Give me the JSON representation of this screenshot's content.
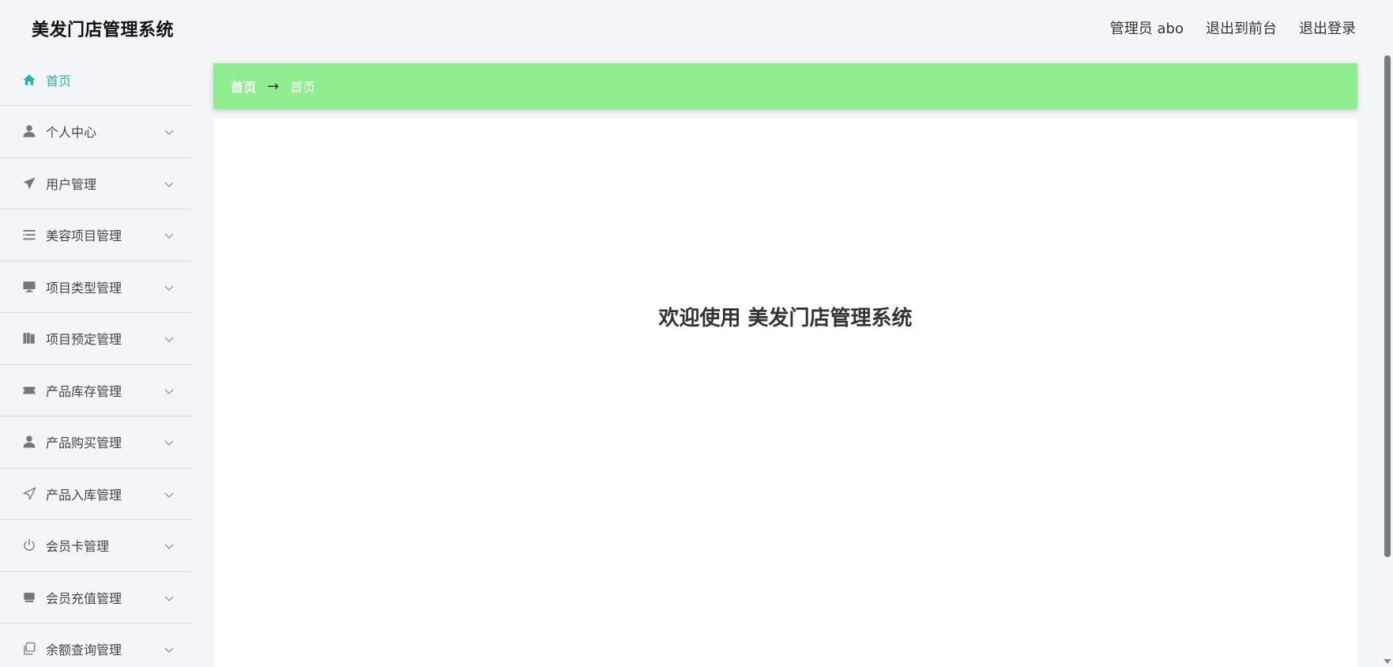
{
  "app": {
    "title": "美发门店管理系统"
  },
  "header": {
    "user_label": "管理员 abo",
    "front_label": "退出到前台",
    "logout_label": "退出登录"
  },
  "sidebar": {
    "items": [
      {
        "label": "首页",
        "icon": "home-icon"
      },
      {
        "label": "个人中心",
        "icon": "user-icon"
      },
      {
        "label": "用户管理",
        "icon": "paper-plane-icon"
      },
      {
        "label": "美容项目管理",
        "icon": "list-icon"
      },
      {
        "label": "项目类型管理",
        "icon": "monitor-icon"
      },
      {
        "label": "项目预定管理",
        "icon": "books-icon"
      },
      {
        "label": "产品库存管理",
        "icon": "ticket-icon"
      },
      {
        "label": "产品购买管理",
        "icon": "person-icon"
      },
      {
        "label": "产品入库管理",
        "icon": "send-icon"
      },
      {
        "label": "会员卡管理",
        "icon": "power-icon"
      },
      {
        "label": "会员充值管理",
        "icon": "inbox-icon"
      },
      {
        "label": "余额查询管理",
        "icon": "copy-icon"
      }
    ]
  },
  "breadcrumb": {
    "home": "首页",
    "separator": "→",
    "current": "首页"
  },
  "main": {
    "welcome": "欢迎使用 美发门店管理系统"
  },
  "colors": {
    "accent": "#2bb5a8",
    "breadcrumb_bg": "#90ee90"
  }
}
